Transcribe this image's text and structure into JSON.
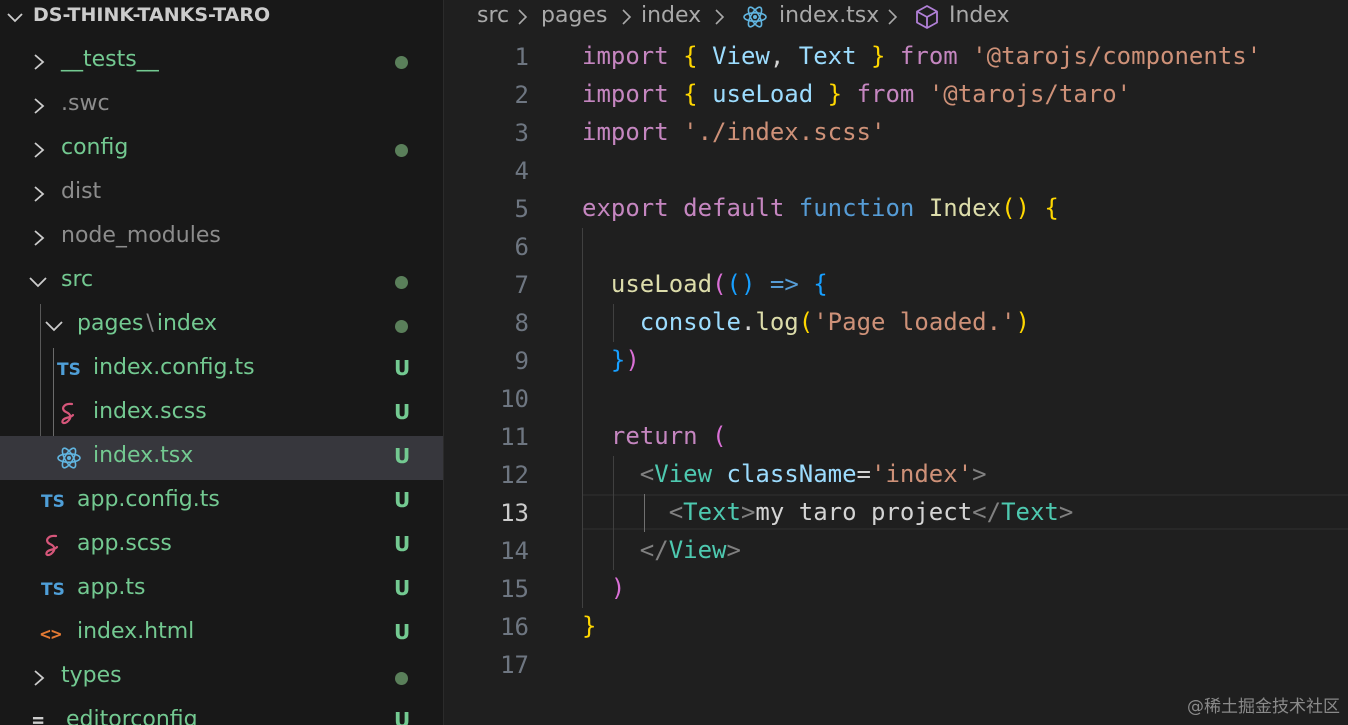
{
  "explorer": {
    "root_title": "DS-THINK-TANKS-TARO",
    "items": [
      {
        "name": "__tests__",
        "status": "dot"
      },
      {
        "name": ".swc",
        "status": ""
      },
      {
        "name": "config",
        "status": "dot"
      },
      {
        "name": "dist",
        "status": ""
      },
      {
        "name": "node_modules",
        "status": ""
      },
      {
        "name": "src",
        "status": "dot"
      },
      {
        "name": "pages",
        "name_sep": "\\",
        "name_tail": "index",
        "status": "dot"
      },
      {
        "name": "index.config.ts",
        "icon_text": "TS",
        "status": "U"
      },
      {
        "name": "index.scss",
        "status": "U"
      },
      {
        "name": "index.tsx",
        "status": "U"
      },
      {
        "name": "app.config.ts",
        "icon_text": "TS",
        "status": "U"
      },
      {
        "name": "app.scss",
        "status": "U"
      },
      {
        "name": "app.ts",
        "icon_text": "TS",
        "status": "U"
      },
      {
        "name": "index.html",
        "icon_text": "<>",
        "status": "U"
      },
      {
        "name": "types",
        "status": "dot"
      },
      {
        "name": "editorconfig",
        "icon_text": "≡",
        "status": "U"
      }
    ]
  },
  "breadcrumb": {
    "parts": [
      "src",
      "pages",
      "index",
      "index.tsx",
      "Index"
    ]
  },
  "editor": {
    "current_line": 13,
    "lines": [
      {
        "n": "1",
        "tokens": [
          [
            "kw",
            "import"
          ],
          [
            "txt",
            " "
          ],
          [
            "b1",
            "{"
          ],
          [
            "txt",
            " "
          ],
          [
            "var",
            "View"
          ],
          [
            "txt",
            ", "
          ],
          [
            "var",
            "Text"
          ],
          [
            "txt",
            " "
          ],
          [
            "b1",
            "}"
          ],
          [
            "txt",
            " "
          ],
          [
            "kw",
            "from"
          ],
          [
            "txt",
            " "
          ],
          [
            "str",
            "'@tarojs/components'"
          ]
        ]
      },
      {
        "n": "2",
        "tokens": [
          [
            "kw",
            "import"
          ],
          [
            "txt",
            " "
          ],
          [
            "b1",
            "{"
          ],
          [
            "txt",
            " "
          ],
          [
            "var",
            "useLoad"
          ],
          [
            "txt",
            " "
          ],
          [
            "b1",
            "}"
          ],
          [
            "txt",
            " "
          ],
          [
            "kw",
            "from"
          ],
          [
            "txt",
            " "
          ],
          [
            "str",
            "'@tarojs/taro'"
          ]
        ]
      },
      {
        "n": "3",
        "tokens": [
          [
            "kw",
            "import"
          ],
          [
            "txt",
            " "
          ],
          [
            "str",
            "'./index.scss'"
          ]
        ]
      },
      {
        "n": "4",
        "tokens": []
      },
      {
        "n": "5",
        "tokens": [
          [
            "kw",
            "export"
          ],
          [
            "txt",
            " "
          ],
          [
            "kw",
            "default"
          ],
          [
            "txt",
            " "
          ],
          [
            "kw2",
            "function"
          ],
          [
            "txt",
            " "
          ],
          [
            "fn",
            "Index"
          ],
          [
            "b1",
            "()"
          ],
          [
            "txt",
            " "
          ],
          [
            "b1",
            "{"
          ]
        ]
      },
      {
        "n": "6",
        "tokens": []
      },
      {
        "n": "7",
        "tokens": [
          [
            "txt",
            "  "
          ],
          [
            "fn",
            "useLoad"
          ],
          [
            "b2",
            "("
          ],
          [
            "b3",
            "()"
          ],
          [
            "txt",
            " "
          ],
          [
            "kw2",
            "=>"
          ],
          [
            "txt",
            " "
          ],
          [
            "b3",
            "{"
          ]
        ]
      },
      {
        "n": "8",
        "tokens": [
          [
            "txt",
            "    "
          ],
          [
            "var",
            "console"
          ],
          [
            "txt",
            "."
          ],
          [
            "fn",
            "log"
          ],
          [
            "b1",
            "("
          ],
          [
            "str",
            "'Page loaded.'"
          ],
          [
            "b1",
            ")"
          ]
        ]
      },
      {
        "n": "9",
        "tokens": [
          [
            "txt",
            "  "
          ],
          [
            "b3",
            "}"
          ],
          [
            "b2",
            ")"
          ]
        ]
      },
      {
        "n": "10",
        "tokens": []
      },
      {
        "n": "11",
        "tokens": [
          [
            "txt",
            "  "
          ],
          [
            "kw",
            "return"
          ],
          [
            "txt",
            " "
          ],
          [
            "b2",
            "("
          ]
        ]
      },
      {
        "n": "12",
        "tokens": [
          [
            "txt",
            "    "
          ],
          [
            "punc",
            "<"
          ],
          [
            "tag",
            "View"
          ],
          [
            "txt",
            " "
          ],
          [
            "var",
            "className"
          ],
          [
            "txt",
            "="
          ],
          [
            "str",
            "'index'"
          ],
          [
            "punc",
            ">"
          ]
        ]
      },
      {
        "n": "13",
        "tokens": [
          [
            "txt",
            "      "
          ],
          [
            "punc",
            "<"
          ],
          [
            "tag",
            "Text"
          ],
          [
            "punc",
            ">"
          ],
          [
            "txt",
            "my taro project"
          ],
          [
            "punc",
            "</"
          ],
          [
            "tag",
            "Text"
          ],
          [
            "punc",
            ">"
          ]
        ]
      },
      {
        "n": "14",
        "tokens": [
          [
            "txt",
            "    "
          ],
          [
            "punc",
            "</"
          ],
          [
            "tag",
            "View"
          ],
          [
            "punc",
            ">"
          ]
        ]
      },
      {
        "n": "15",
        "tokens": [
          [
            "txt",
            "  "
          ],
          [
            "b2",
            ")"
          ]
        ]
      },
      {
        "n": "16",
        "tokens": [
          [
            "b1",
            "}"
          ]
        ]
      },
      {
        "n": "17",
        "tokens": []
      }
    ]
  },
  "watermark": "@稀土掘金技术社区",
  "colors": {
    "accent_modified": "#73c991",
    "ts_icon": "#4f9fd8",
    "html_icon": "#e37933",
    "sass_icon": "#d6567a",
    "react_icon": "#61b5e0"
  }
}
